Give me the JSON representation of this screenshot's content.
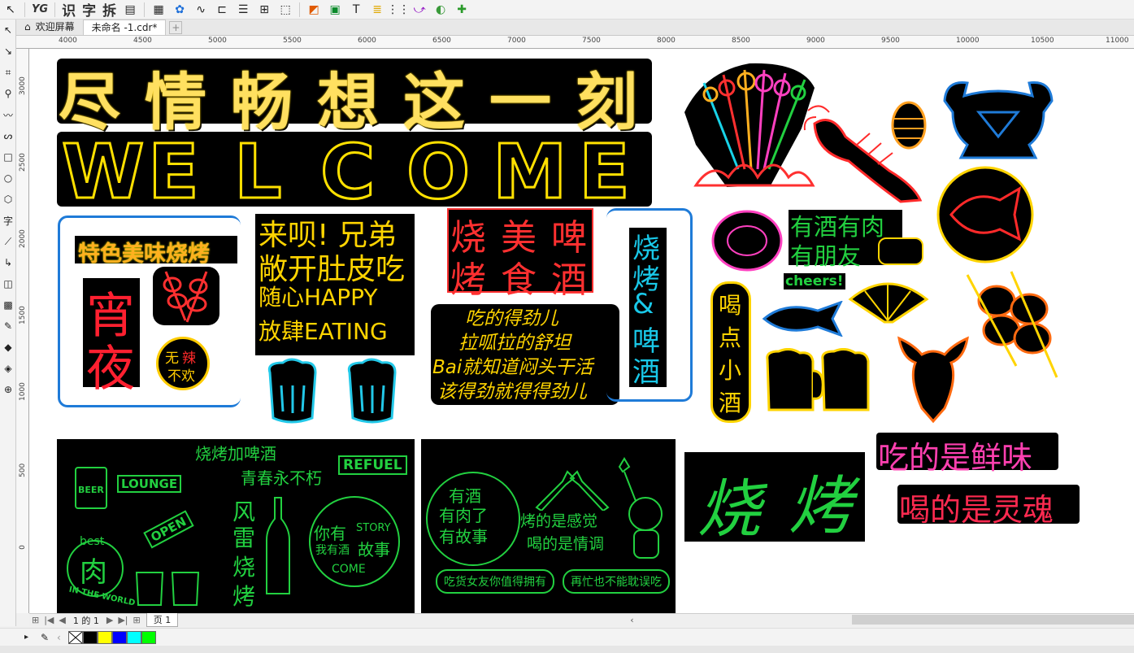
{
  "toolbar": {
    "items": [
      "YG",
      "识",
      "字",
      "拆"
    ]
  },
  "tabs": [
    {
      "label": "欢迎屏幕"
    },
    {
      "label": "未命名 -1.cdr*"
    }
  ],
  "ruler": {
    "h_labels": [
      "4000",
      "4500",
      "5000",
      "5500",
      "6000",
      "6500",
      "7000",
      "7500",
      "8000",
      "8500",
      "9000",
      "9500",
      "10000",
      "10500",
      "11000"
    ],
    "v_labels": [
      "3000",
      "2500",
      "2000",
      "1500",
      "1000",
      "500",
      "0"
    ]
  },
  "artwork": {
    "title_cn": [
      "尽",
      "情",
      "畅",
      "想",
      "这",
      "一",
      "刻"
    ],
    "welcome": [
      "W",
      "E",
      "L",
      "C",
      "O",
      "M",
      "E"
    ],
    "bbq_special": "特色美味烧烤",
    "night": [
      "宵",
      "夜"
    ],
    "no_spicy": [
      "无",
      "辣",
      "不欢"
    ],
    "brother": [
      "来呗! 兄弟",
      "敞开肚皮吃",
      "随心HAPPY",
      "放肆EATING"
    ],
    "food_beer_a": [
      "烧",
      "美",
      "啤"
    ],
    "food_beer_b": [
      "烤",
      "食",
      "酒"
    ],
    "poem": [
      "吃的得劲儿",
      "拉呱拉的舒坦",
      "Bai就知道闷头干活",
      "该得劲就得得劲儿"
    ],
    "bbq_beer_vertical": [
      "烧",
      "烤",
      "&",
      "啤",
      "酒"
    ],
    "wine_meat": [
      "有酒有肉",
      "有朋友"
    ],
    "cheers": "cheers!",
    "drink_a_bit": [
      "喝",
      "点",
      "小",
      "酒"
    ],
    "fresh": "吃的是鲜味",
    "soul": "喝的是灵魂",
    "panel1": {
      "bbq_beer": "烧烤加啤酒",
      "youth": "青春永不朽",
      "refuel": "REFUEL",
      "beer": "BEER",
      "lounge": "LOUNGE",
      "open": "OPEN",
      "fengyun": [
        "风",
        "雷",
        "烧",
        "烤"
      ],
      "best": "best",
      "meat": "肉",
      "in_the_world": "IN THE WORLD",
      "story_a": "你有",
      "story_b": "STORY",
      "story_c": "我有酒",
      "story_d": "故事",
      "come": "COME"
    },
    "panel2": {
      "circle": [
        "有酒",
        "有肉了",
        "有故事"
      ],
      "feeling_a": "烤的是感觉",
      "feeling_b": "喝的是情调",
      "pill_a": "吃货女友你值得拥有",
      "pill_b": "再忙也不能耽误吃"
    },
    "panel3": {
      "chars": [
        "烧",
        "烤"
      ]
    }
  },
  "pagebar": {
    "page_count": "1 的 1",
    "page_tab": "页 1"
  },
  "palette": {
    "colors": [
      "#000000",
      "#ffff00",
      "#0000ff",
      "#00ffff",
      "#00ff00"
    ]
  }
}
